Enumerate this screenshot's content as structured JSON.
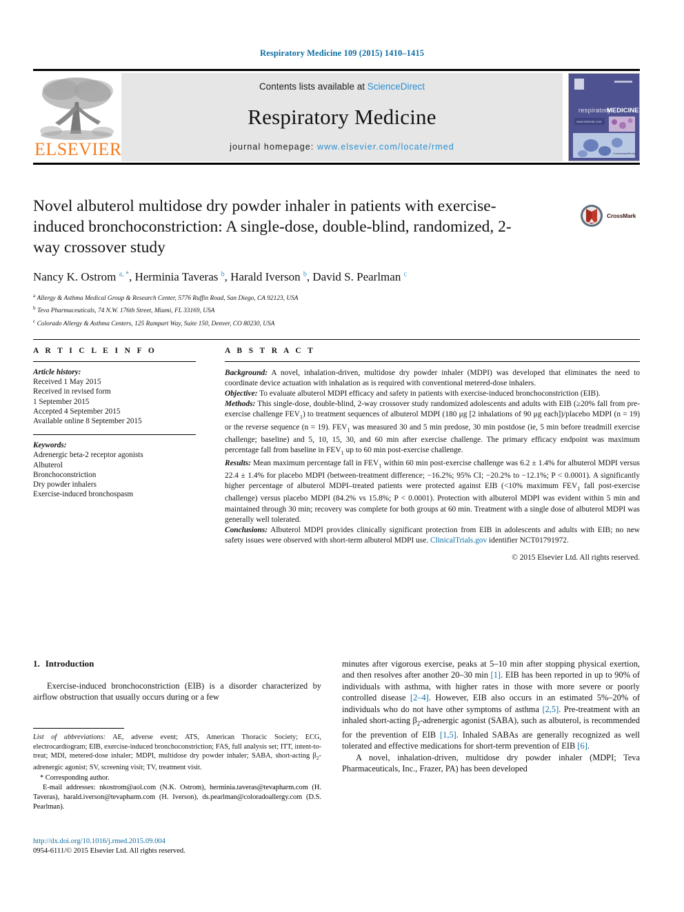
{
  "running_head": "Respiratory Medicine 109 (2015) 1410–1415",
  "header": {
    "contents_prefix": "Contents lists available at ",
    "sciencedirect": "ScienceDirect",
    "journal_name": "Respiratory Medicine",
    "homepage_prefix": "journal homepage: ",
    "homepage_url": "www.elsevier.com/locate/rmed",
    "publisher_logo_text": "ELSEVIER",
    "cover_journal_title": "respiratoryMEDICINE",
    "cover_url_text": "www.elsevier.com",
    "accent_link_color": "#2a8fd0",
    "elsevier_orange": "#F47C20",
    "band_bg": "#e6e6e6"
  },
  "crossmark": {
    "label": "CrossMark"
  },
  "title": "Novel albuterol multidose dry powder inhaler in patients with exercise-induced bronchoconstriction: A single-dose, double-blind, randomized, 2-way crossover study",
  "authors_html": "Nancy K. Ostrom <sup>a, *</sup>, Herminia Taveras <sup>b</sup>, Harald Iverson <sup>b</sup>, David S. Pearlman <sup>c</sup>",
  "affiliations": [
    {
      "mark": "a",
      "text": "Allergy & Asthma Medical Group & Research Center, 5776 Ruffin Road, San Diego, CA 92123, USA"
    },
    {
      "mark": "b",
      "text": "Teva Pharmaceuticals, 74 N.W. 176th Street, Miami, FL 33169, USA"
    },
    {
      "mark": "c",
      "text": "Colorado Allergy & Asthma Centers, 125 Rampart Way, Suite 150, Denver, CO 80230, USA"
    }
  ],
  "article_info": {
    "heading": "A R T I C L E   I N F O",
    "history_label": "Article history:",
    "history_lines": [
      "Received 1 May 2015",
      "Received in revised form",
      "1 September 2015",
      "Accepted 4 September 2015",
      "Available online 8 September 2015"
    ],
    "keywords_label": "Keywords:",
    "keywords": [
      "Adrenergic beta-2 receptor agonists",
      "Albuterol",
      "Bronchoconstriction",
      "Dry powder inhalers",
      "Exercise-induced bronchospasm"
    ]
  },
  "abstract": {
    "heading": "A B S T R A C T",
    "background_label": "Background:",
    "background_text": " A novel, inhalation-driven, multidose dry powder inhaler (MDPI) was developed that eliminates the need to coordinate device actuation with inhalation as is required with conventional metered-dose inhalers.",
    "objective_label": "Objective:",
    "objective_text": " To evaluate albuterol MDPI efficacy and safety in patients with exercise-induced bronchoconstriction (EIB).",
    "methods_label": "Methods:",
    "methods_text_1": " This single-dose, double-blind, 2-way crossover study randomized adolescents and adults with EIB (≥20% fall from pre-exercise challenge FEV",
    "methods_text_2": ") to treatment sequences of albuterol MDPI (180 μg [2 inhalations of 90 μg each])/placebo MDPI (n = 19) or the reverse sequence (n = 19). FEV",
    "methods_text_3": " was measured 30 and 5 min predose, 30 min postdose (ie, 5 min before treadmill exercise challenge; baseline) and 5, 10, 15, 30, and 60 min after exercise challenge. The primary efficacy endpoint was maximum percentage fall from baseline in FEV",
    "methods_text_4": " up to 60 min post-exercise challenge.",
    "results_label": "Results:",
    "results_text_1": " Mean maximum percentage fall in FEV",
    "results_text_2": " within 60 min post-exercise challenge was 6.2 ± 1.4% for albuterol MDPI versus 22.4 ± 1.4% for placebo MDPI (between-treatment difference; −16.2%; 95% CI; −20.2% to −12.1%; P < 0.0001). A significantly higher percentage of albuterol MDPI–treated patients were protected against EIB (<10% maximum FEV",
    "results_text_3": " fall post-exercise challenge) versus placebo MDPI (84.2% vs 15.8%; P < 0.0001). Protection with albuterol MDPI was evident within 5 min and maintained through 30 min; recovery was complete for both groups at 60 min. Treatment with a single dose of albuterol MDPI was generally well tolerated.",
    "conclusions_label": "Conclusions:",
    "conclusions_text_1": " Albuterol MDPI provides clinically significant protection from EIB in adolescents and adults with EIB; no new safety issues were observed with short-term albuterol MDPI use. ",
    "conclusions_link": "ClinicalTrials.gov",
    "conclusions_text_2": " identifier NCT01791972.",
    "copyright": "© 2015 Elsevier Ltd. All rights reserved.",
    "subscript_1": "1"
  },
  "introduction": {
    "number": "1.",
    "heading": "Introduction",
    "paragraph_left_1": "Exercise-induced bronchoconstriction (EIB) is a disorder characterized by airflow obstruction that usually occurs during or a few",
    "paragraph_right_1a": "minutes after vigorous exercise, peaks at 5–10 min after stopping physical exertion, and then resolves after another 20–30 min ",
    "ref_1": "[1]",
    "paragraph_right_1b": ". EIB has been reported in up to 90% of individuals with asthma, with higher rates in those with more severe or poorly controlled disease ",
    "ref_2_4": "[2–4]",
    "paragraph_right_1c": ". However, EIB also occurs in an estimated 5%–20% of individuals who do not have other symptoms of asthma ",
    "ref_2_5": "[2,5]",
    "paragraph_right_1d": ". Pre-treatment with an inhaled short-acting β",
    "beta_sub": "2",
    "paragraph_right_1e": "-adrenergic agonist (SABA), such as albuterol, is recommended for the prevention of EIB ",
    "ref_1_5": "[1,5]",
    "paragraph_right_1f": ". Inhaled SABAs are generally recognized as well tolerated and effective medications for short-term prevention of EIB ",
    "ref_6": "[6]",
    "paragraph_right_1g": ".",
    "paragraph_right_2": "A novel, inhalation-driven, multidose dry powder inhaler (MDPI; Teva Pharmaceuticals, Inc., Frazer, PA) has been developed"
  },
  "footnote": {
    "abbrev_label": "List of abbreviations:",
    "abbrev_text_a": " AE, adverse event; ATS, American Thoracic Society; ECG, electrocardiogram; EIB, exercise-induced bronchoconstriction; FAS, full analysis set; ITT, intent-to-treat; MDI, metered-dose inhaler; MDPI, multidose dry powder inhaler; SABA, short-acting β",
    "abbrev_beta_sub": "2",
    "abbrev_text_b": "-adrenergic agonist; SV, screening visit; TV, treatment visit.",
    "corresponding": "* Corresponding author.",
    "email_label": "E-mail addresses:",
    "emails": [
      {
        "address": "nkostrom@aol.com",
        "person": "(N.K. Ostrom)"
      },
      {
        "address": "herminia.taveras@tevapharm.com",
        "person": "(H. Taveras)"
      },
      {
        "address": "harald.iverson@tevapharm.com",
        "person": "(H. Iverson)"
      },
      {
        "address": "ds.pearlman@coloradoallergy.com",
        "person": "(D.S. Pearlman)"
      }
    ]
  },
  "bottom": {
    "doi": "http://dx.doi.org/10.1016/j.rmed.2015.09.004",
    "issn_copyright": "0954-6111/© 2015 Elsevier Ltd. All rights reserved."
  }
}
